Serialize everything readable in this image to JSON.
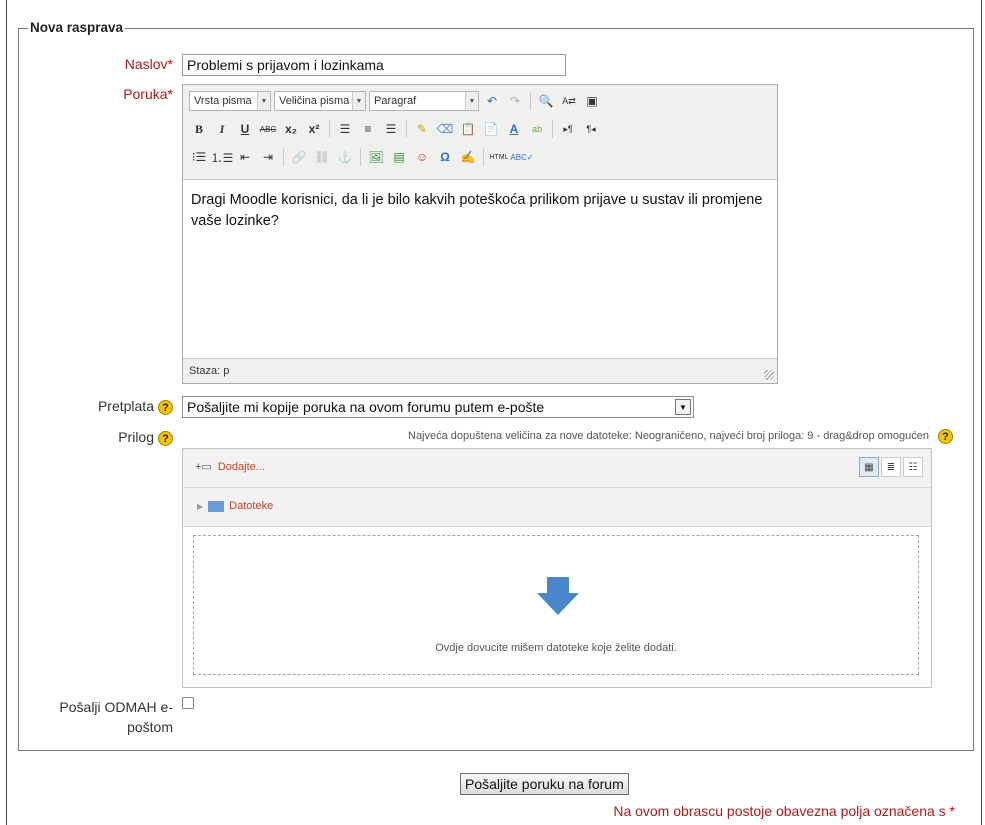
{
  "form": {
    "legend": "Nova rasprava",
    "required_marker": "*",
    "subject": {
      "label": "Naslov",
      "value": "Problemi s prijavom i lozinkama"
    },
    "message": {
      "label": "Poruka",
      "toolbar": {
        "font_family": "Vrsta pisma",
        "font_size": "Veličina pisma",
        "format": "Paragraf"
      },
      "body": "Dragi Moodle korisnici, da li je bilo kakvih poteškoća prilikom prijave u sustav ili promjene vaše lozinke?",
      "path": "Staza: p"
    },
    "subscription": {
      "label": "Pretplata",
      "value": "Pošaljite mi kopije poruka na ovom forumu putem e-pošte"
    },
    "attachment": {
      "label": "Prilog",
      "max_size_note": "Najveća dopuštena veličina za nove datoteke: Neograničeno, najveći broj priloga: 9 - drag&drop omogućen",
      "add_label": "Dodajte...",
      "folder_label": "Datoteke",
      "drop_message": "Ovdje dovucite mišem datoteke koje želite dodati."
    },
    "mail_now": {
      "label_line1": "Pošalji ODMAH e-",
      "label_line2": "poštom",
      "checked": false
    },
    "submit_label": "Pošaljite poruku na forum",
    "required_note": "Na ovom obrascu postoje obavezna polja označena s"
  },
  "colors": {
    "required_label": "#aa1a1a",
    "help_icon": "#f5c400",
    "drop_arrow": "#4a86c8",
    "link_orange": "#c3452a"
  }
}
